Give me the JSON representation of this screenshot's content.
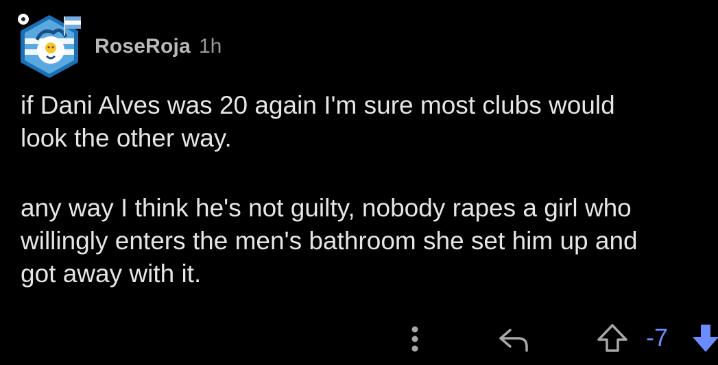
{
  "comment": {
    "username": "RoseRoja",
    "timestamp": "1h",
    "body": [
      "if Dani Alves was 20 again I'm sure most clubs would",
      "look the other way.",
      "any way I think he's not guilty, nobody rapes a girl who",
      "willingly enters the men's bathroom she set him up and",
      "got away with it."
    ],
    "score": "-7"
  },
  "icons": {
    "avatar": "argentina-mascot-avatar-icon",
    "more": "more-vertical-icon",
    "reply": "reply-arrow-icon",
    "upvote": "upvote-arrow-icon",
    "downvote": "downvote-arrow-icon"
  },
  "colors": {
    "background": "#000000",
    "body_text": "#e6e6e6",
    "username": "#b9b9b9",
    "timestamp": "#9a9a9a",
    "score_downvoted": "#6b8cff",
    "downvote_active": "#6b8cff",
    "icon_gray": "#a8a8a8"
  }
}
